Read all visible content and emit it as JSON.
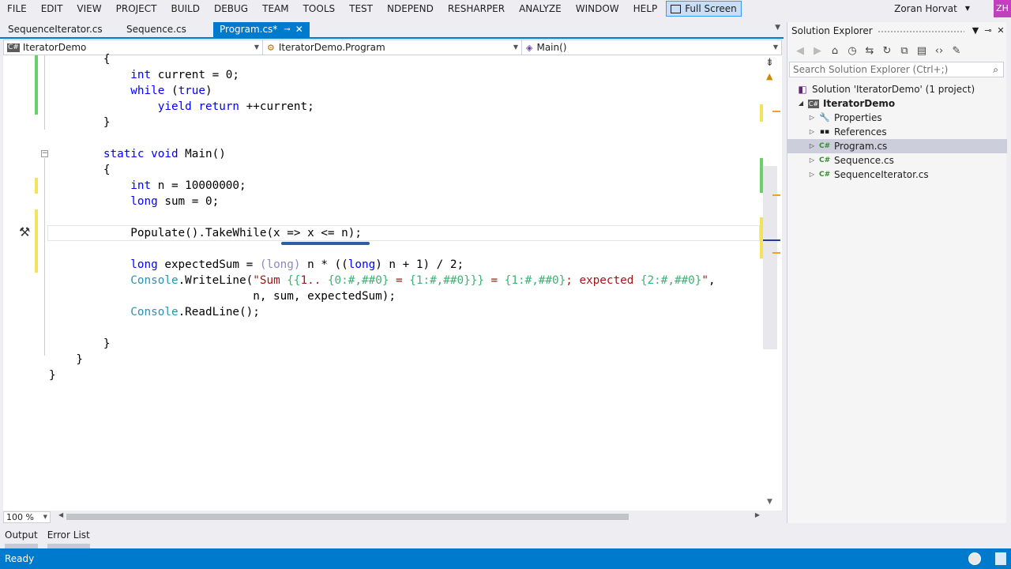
{
  "menu": [
    "FILE",
    "EDIT",
    "VIEW",
    "PROJECT",
    "BUILD",
    "DEBUG",
    "TEAM",
    "TOOLS",
    "TEST",
    "NDEPEND",
    "RESHARPER",
    "ANALYZE",
    "WINDOW",
    "HELP"
  ],
  "full_screen_label": "Full Screen",
  "user": {
    "name": "Zoran Horvat",
    "initials": "ZH"
  },
  "tabs": [
    {
      "label": "SequenceIterator.cs",
      "active": false
    },
    {
      "label": "Sequence.cs",
      "active": false
    },
    {
      "label": "Program.cs*",
      "active": true
    }
  ],
  "navbar": {
    "project": "IteratorDemo",
    "type": "IteratorDemo.Program",
    "member": "Main()"
  },
  "code_lines": [
    "        {",
    "            int current = 0;",
    "            while (true)",
    "                yield return ++current;",
    "        }",
    "",
    "        static void Main()",
    "        {",
    "            int n = 10000000;",
    "            long sum = 0;",
    "",
    "            Populate().TakeWhile(x => x <= n);",
    "",
    "            long expectedSum = (long) n * ((long) n + 1) / 2;",
    "            Console.WriteLine(\"Sum {{1.. {0:#,##0} = {1:#,##0}}} = {1:#,##0}; expected {2:#,##0}\",",
    "                              n, sum, expectedSum);",
    "            Console.ReadLine();",
    "",
    "        }",
    "    }",
    "}"
  ],
  "zoom": "100 %",
  "bottom_tabs": [
    "Output",
    "Error List"
  ],
  "status": "Ready",
  "solution_explorer": {
    "title": "Solution Explorer",
    "search_placeholder": "Search Solution Explorer (Ctrl+;)",
    "nodes": [
      {
        "label": "Solution 'IteratorDemo' (1 project)",
        "icon": "solution-icon"
      },
      {
        "label": "IteratorDemo",
        "icon": "csharp-project-icon"
      },
      {
        "label": "Properties",
        "icon": "wrench-icon"
      },
      {
        "label": "References",
        "icon": "references-icon"
      },
      {
        "label": "Program.cs",
        "icon": "csharp-file-icon",
        "selected": true
      },
      {
        "label": "Sequence.cs",
        "icon": "csharp-file-icon"
      },
      {
        "label": "SequenceIterator.cs",
        "icon": "csharp-file-icon"
      }
    ]
  },
  "colors": {
    "accent": "#007acc",
    "keyword": "#0000ff",
    "type": "#2b91af",
    "string": "#a31515",
    "format": "#3cb371",
    "change_saved": "#6ad16a",
    "change_unsaved": "#f2e25c"
  }
}
